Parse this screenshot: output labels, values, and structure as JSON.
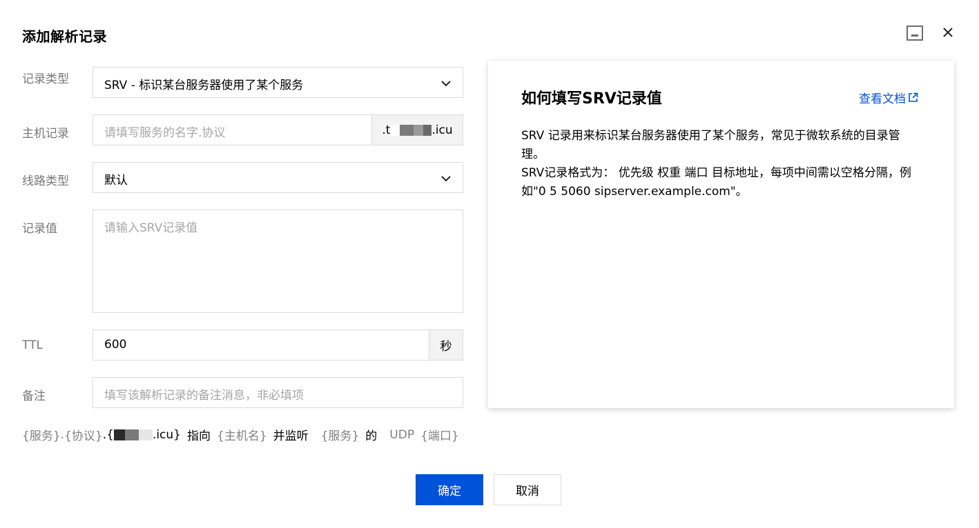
{
  "dialog": {
    "title": "添加解析记录"
  },
  "form": {
    "record_type": {
      "label": "记录类型",
      "value": "SRV - 标识某台服务器使用了某个服务"
    },
    "host": {
      "label": "主机记录",
      "placeholder": "请填写服务的名字.协议",
      "suffix_prefix": ".t",
      "suffix_tld": ".icu"
    },
    "line_type": {
      "label": "线路类型",
      "value": "默认"
    },
    "record_value": {
      "label": "记录值",
      "placeholder": "请输入SRV记录值"
    },
    "ttl": {
      "label": "TTL",
      "value": "600",
      "unit": "秒"
    },
    "remark": {
      "label": "备注",
      "placeholder": "填写该解析记录的备注消息，非必填项"
    }
  },
  "preview": {
    "service": "{服务}",
    "dot1": ".",
    "protocol": "{协议}",
    "domain_open": ".{",
    "domain_tail": ".icu}",
    "points_to": "指向",
    "hostname": "{主机名}",
    "and_listen": "并监听",
    "service2": "{服务}",
    "of": "的",
    "udp": "UDP",
    "port": "{端口}"
  },
  "buttons": {
    "confirm": "确定",
    "cancel": "取消"
  },
  "help": {
    "title": "如何填写SRV记录值",
    "doc_link": "查看文档",
    "para1": "SRV 记录用来标识某台服务器使用了某个服务，常见于微软系统的目录管理。",
    "para2": "SRV记录格式为： 优先级 权重 端口 目标地址，每项中间需以空格分隔，例如\"0 5 5060 sipserver.example.com\"。"
  },
  "colors": {
    "primary": "#0052d9",
    "label": "#777777",
    "placeholder": "#a6a6a6",
    "border": "#dcdcdc"
  },
  "icons": [
    "minimize-icon",
    "close-icon",
    "chevron-down-icon",
    "external-link-icon"
  ]
}
